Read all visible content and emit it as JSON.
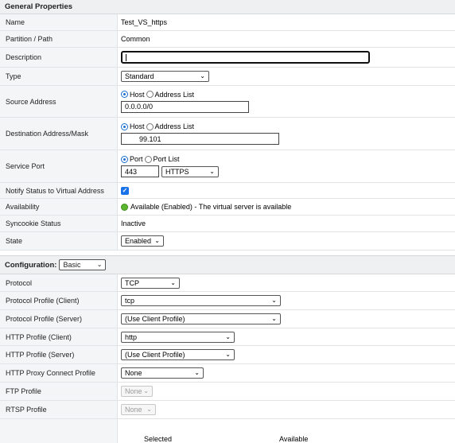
{
  "general": {
    "header": "General Properties",
    "name": {
      "label": "Name",
      "value": "Test_VS_https"
    },
    "partition": {
      "label": "Partition / Path",
      "value": "Common"
    },
    "description": {
      "label": "Description",
      "value": ""
    },
    "type": {
      "label": "Type",
      "value": "Standard"
    },
    "source": {
      "label": "Source Address",
      "opt_host": "Host",
      "opt_list": "Address List",
      "value": "0.0.0.0/0"
    },
    "destination": {
      "label": "Destination Address/Mask",
      "opt_host": "Host",
      "opt_list": "Address List",
      "value": "99.101"
    },
    "port": {
      "label": "Service Port",
      "opt_port": "Port",
      "opt_list": "Port List",
      "value": "443",
      "service": "HTTPS"
    },
    "notify": {
      "label": "Notify Status to Virtual Address",
      "checked": true
    },
    "availability": {
      "label": "Availability",
      "value": "Available (Enabled) - The virtual server is available",
      "status_color": "#5cb630"
    },
    "syncookie": {
      "label": "Syncookie Status",
      "value": "Inactive"
    },
    "state": {
      "label": "State",
      "value": "Enabled"
    }
  },
  "config": {
    "header": "Configuration:",
    "mode": "Basic",
    "protocol": {
      "label": "Protocol",
      "value": "TCP"
    },
    "profile_client": {
      "label": "Protocol Profile (Client)",
      "value": "tcp"
    },
    "profile_server": {
      "label": "Protocol Profile (Server)",
      "value": "(Use Client Profile)"
    },
    "http_client": {
      "label": "HTTP Profile (Client)",
      "value": "http"
    },
    "http_server": {
      "label": "HTTP Profile (Server)",
      "value": "(Use Client Profile)"
    },
    "http_proxy": {
      "label": "HTTP Proxy Connect Profile",
      "value": "None"
    },
    "ftp": {
      "label": "FTP Profile",
      "value": "None"
    },
    "rtsp": {
      "label": "RTSP Profile",
      "value": "None"
    },
    "lists": {
      "selected": "Selected",
      "available": "Available"
    }
  },
  "accent_color": "#1a73e8"
}
